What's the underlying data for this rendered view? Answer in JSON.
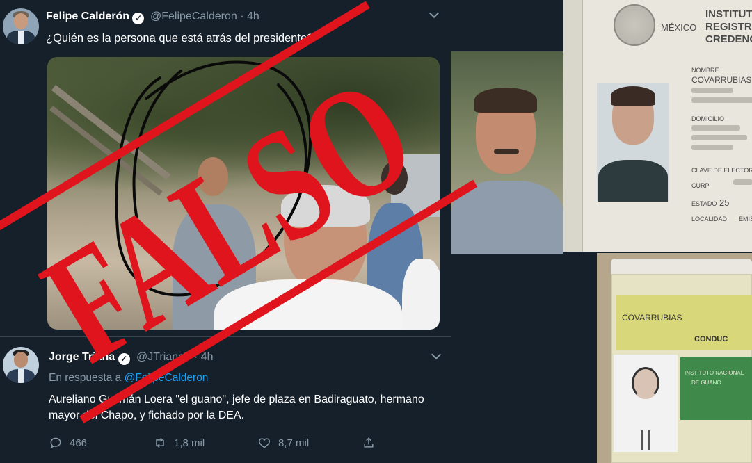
{
  "tweet1": {
    "author_name": "Felipe Calderón",
    "verified_glyph": "✓",
    "handle": "@FelipeCalderon",
    "separator": "·",
    "time": "4h",
    "text": "¿Quién es la persona que está atrás del presidente?"
  },
  "id_card": {
    "mexico": "MÉXICO",
    "institute": "INSTITUTO",
    "registry": "REGISTRO FE",
    "credential": "CREDENCIAL",
    "nombre_label": "NOMBRE",
    "nombre_value": "COVARRUBIAS",
    "domicilio_label": "DOMICILIO",
    "clave_label": "CLAVE DE ELECTOR",
    "curp_label": "CURP",
    "estado_label": "ESTADO",
    "estado_value": "25",
    "localidad_label": "LOCALIDAD",
    "emis_label": "EMIS"
  },
  "badge_card": {
    "name": "COVARRUBIAS",
    "line2": "CONDUC",
    "line3": "INSTITUTO NACIONAL",
    "line4": "DE GUANO"
  },
  "stamp": {
    "text": "FALSO",
    "color": "#e0141c"
  },
  "tweet2": {
    "author_name": "Jorge Triana",
    "verified_glyph": "✓",
    "handle": "@JTrianaT",
    "separator": "·",
    "time": "4h",
    "reply_prefix": "En respuesta a",
    "reply_mention": "@FelipeCalderon",
    "text_line1": "Aureliano Guzmán Loera \"el guano\", jefe de plaza en Badiraguato, hermano",
    "text_line2": "mayor del Chapo, y fichado por la DEA.",
    "replies": "466",
    "retweets": "1,8 mil",
    "likes": "8,7 mil"
  },
  "icons": {
    "reply": "reply-icon",
    "retweet": "retweet-icon",
    "like": "heart-icon",
    "share": "share-icon",
    "more": "chevron-down-icon"
  },
  "colors": {
    "background": "#15202b",
    "secondary_text": "#8899a6",
    "link": "#1da1f2",
    "stamp_red": "#e0141c"
  }
}
